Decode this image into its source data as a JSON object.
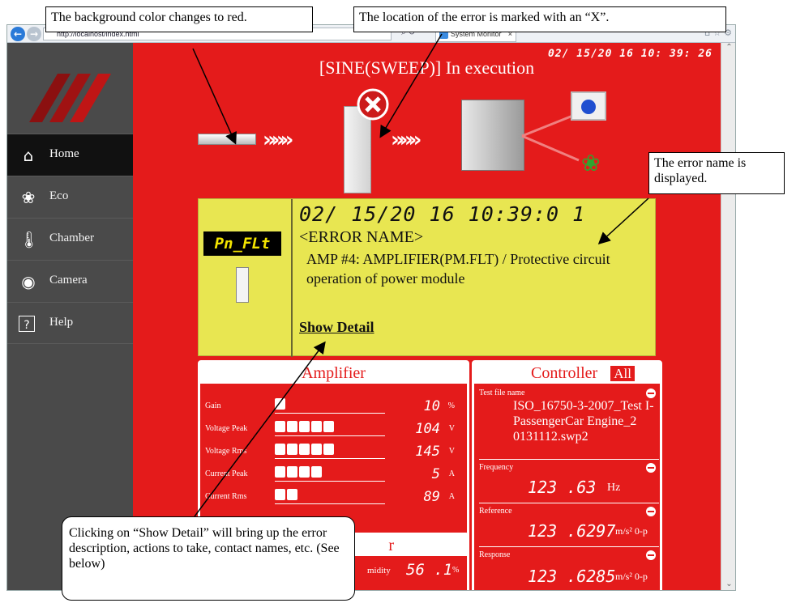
{
  "browser": {
    "url": "http://localhost/index.html",
    "tab_title": "System Monitor",
    "back_icon": "back-arrow-icon",
    "forward_icon": "forward-arrow-icon"
  },
  "sidebar": {
    "items": [
      {
        "label": "Home",
        "icon": "home-icon",
        "active": true
      },
      {
        "label": "Eco",
        "icon": "leaf-icon",
        "active": false
      },
      {
        "label": "Chamber",
        "icon": "thermometer-icon",
        "active": false
      },
      {
        "label": "Camera",
        "icon": "camera-icon",
        "active": false
      },
      {
        "label": "Help",
        "icon": "help-icon",
        "active": false
      }
    ]
  },
  "header": {
    "datetime": "02/ 15/20 16  10: 39: 26",
    "status": "[SINE(SWEEP)] In execution"
  },
  "colors": {
    "alarm_bg": "#e41b1b",
    "panel_yellow": "#e8e651",
    "sidebar": "#4a4a4a"
  },
  "error": {
    "code": "Pn_FLt",
    "datetime": "02/ 15/20 16  10:39:0 1",
    "name_label": "<ERROR NAME>",
    "description": "AMP #4:  AMPLIFIER(PM.FLT) / Protective circuit operation of power module",
    "show_detail": "Show Detail"
  },
  "amplifier": {
    "title": "Amplifier",
    "rows": [
      {
        "label": "Gain",
        "value": "10",
        "unit": "%",
        "level": 0.1
      },
      {
        "label": "Voltage Peak",
        "value": "104",
        "unit": "V",
        "level": 0.5
      },
      {
        "label": "Voltage Rms",
        "value": "145",
        "unit": "V",
        "level": 0.5
      },
      {
        "label": "Current Peak",
        "value": "5",
        "unit": "A",
        "level": 0.4
      },
      {
        "label": "Current Rms",
        "value": "89",
        "unit": "A",
        "level": 0.2
      }
    ]
  },
  "second_card": {
    "title_partial": "r",
    "label_partial": "midity",
    "value": "56 .1",
    "unit": "%"
  },
  "controller": {
    "title": "Controller",
    "all_button": "All",
    "rows": [
      {
        "label": "Test file name",
        "value": "ISO_16750-3-2007_Test I-PassengerCar Engine_2 0131112.swp2",
        "unit": ""
      },
      {
        "label": "Frequency",
        "value": "123 .63",
        "unit": "Hz"
      },
      {
        "label": "Reference",
        "value": "123 .6297",
        "unit": "m/s² 0-p"
      },
      {
        "label": "Response",
        "value": "123 .6285",
        "unit": "m/s² 0-p"
      }
    ]
  },
  "callouts": {
    "background": "The background color changes to red.",
    "location": "The location of the error is marked with an “X”.",
    "errorname": "The error name is displayed.",
    "detail": "Clicking on “Show Detail” will bring up the error description, actions to take, contact names, etc. (See below)"
  }
}
